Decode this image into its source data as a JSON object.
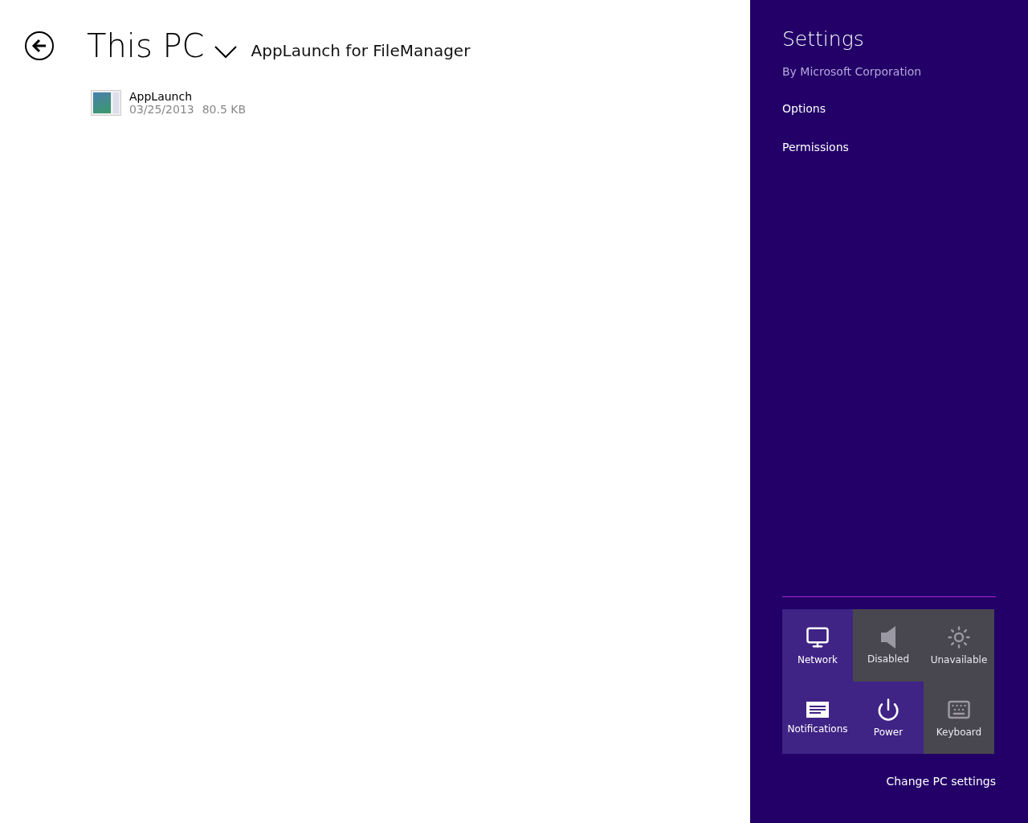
{
  "header": {
    "title": "This PC",
    "subtitle": "AppLaunch for FileManager"
  },
  "files": [
    {
      "name": "AppLaunch",
      "date": "03/25/2013",
      "size": "80.5 KB"
    }
  ],
  "settings": {
    "title": "Settings",
    "publisher": "By Microsoft Corporation",
    "links": [
      "Options",
      "Permissions"
    ],
    "tiles": [
      {
        "kind": "network",
        "label": "Network",
        "disabled": false
      },
      {
        "kind": "volume",
        "label": "Disabled",
        "disabled": true
      },
      {
        "kind": "brightness",
        "label": "Unavailable",
        "disabled": true
      },
      {
        "kind": "notifications",
        "label": "Notifications",
        "disabled": false
      },
      {
        "kind": "power",
        "label": "Power",
        "disabled": false
      },
      {
        "kind": "keyboard",
        "label": "Keyboard",
        "disabled": true
      }
    ],
    "footer_link": "Change PC settings"
  }
}
